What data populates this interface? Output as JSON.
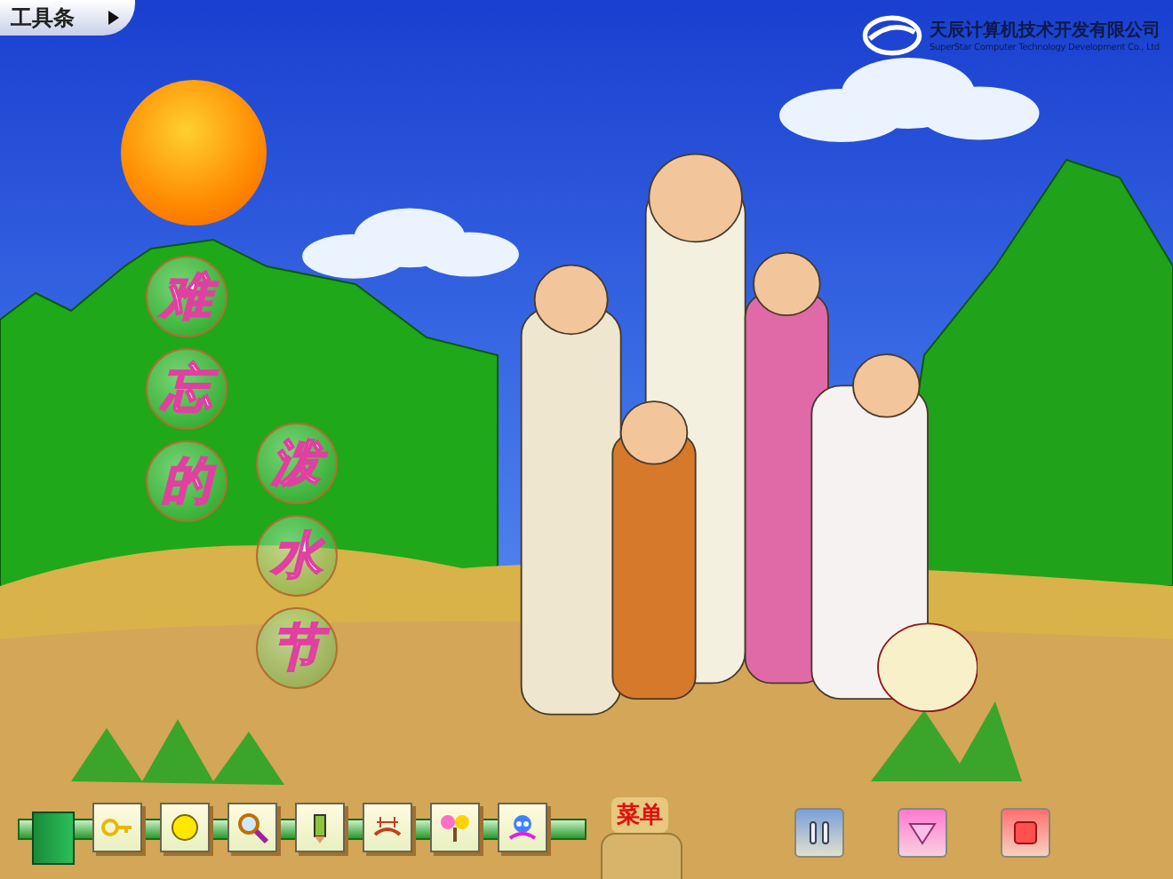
{
  "toolbar_tab": {
    "label": "工具条"
  },
  "logo": {
    "name": "天辰计算机技术开发有限公司",
    "subtitle": "SuperStar Computer Technology Development Co., Ltd"
  },
  "title": {
    "columns": [
      "难忘的",
      "泼水节"
    ]
  },
  "menu_button": {
    "label": "菜单"
  }
}
